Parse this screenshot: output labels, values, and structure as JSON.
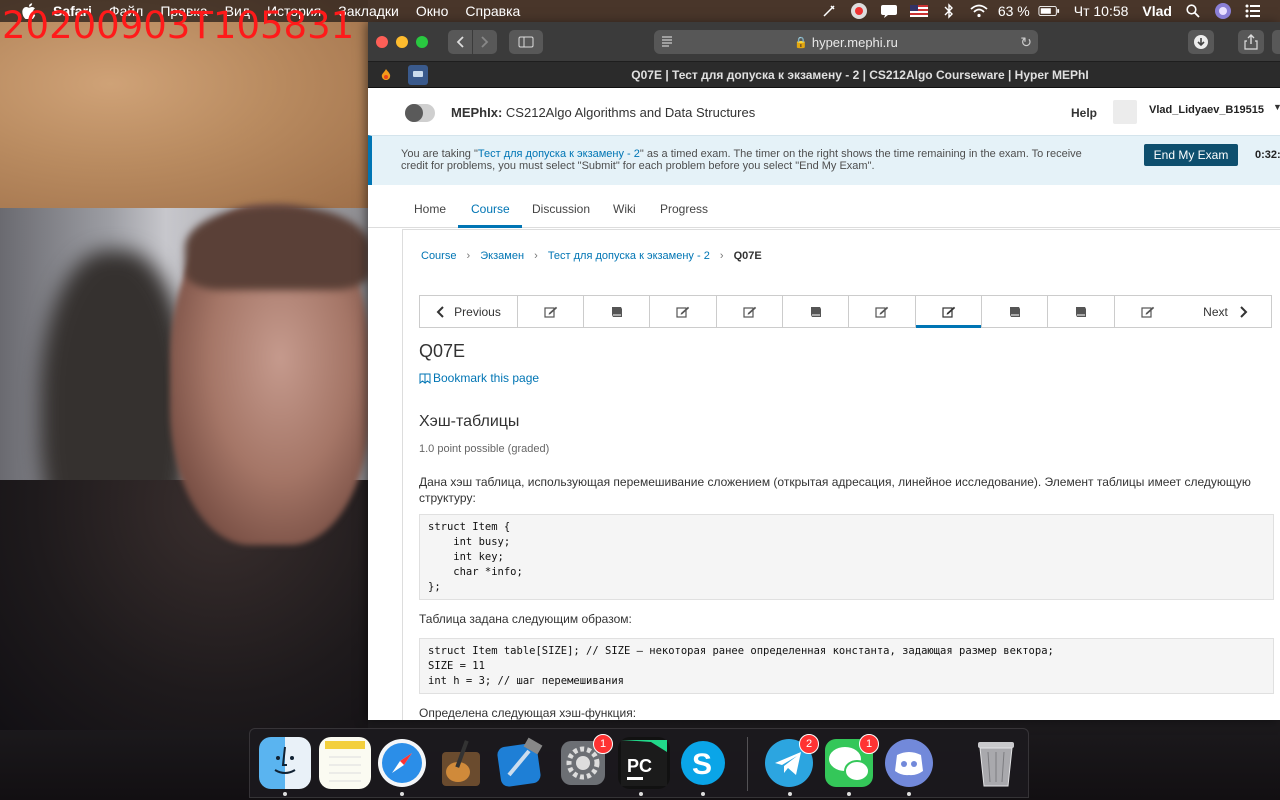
{
  "recording_stamp": "20200903T105831",
  "menubar": {
    "app": "Safari",
    "menus": [
      "Файл",
      "Правка",
      "Вид",
      "История",
      "Закладки",
      "Окно",
      "Справка"
    ],
    "battery": "63 %",
    "clock": "Чт 10:58",
    "user": "Vlad"
  },
  "browser": {
    "url": "hyper.mephi.ru",
    "tab_title": "Q07E | Тест для допуска к экзамену - 2 | CS212Algo Courseware | Hyper MEPhI"
  },
  "header": {
    "platform": "MEPhIx:",
    "course": "CS212Algo Algorithms and Data Structures",
    "help": "Help",
    "username": "Vlad_Lidyaev_B19515"
  },
  "exam_banner": {
    "text_before": "You are taking \"",
    "exam_link": "Тест для допуска к экзамену - 2",
    "text_after": "\" as a timed exam. The timer on the right shows the time remaining in the exam. To receive credit for problems, you must select \"Submit\" for each problem before you select \"End My Exam\".",
    "end_button": "End My Exam",
    "timer": "0:32:"
  },
  "course_tabs": [
    "Home",
    "Course",
    "Discussion",
    "Wiki",
    "Progress"
  ],
  "breadcrumb": {
    "items": [
      "Course",
      "Экзамен",
      "Тест для допуска к экзамену - 2"
    ],
    "current": "Q07E"
  },
  "sequence": {
    "previous": "Previous",
    "next": "Next",
    "items": [
      "edit-icon",
      "book-icon",
      "edit-icon",
      "edit-icon",
      "book-icon",
      "edit-icon",
      "edit-icon",
      "book-icon",
      "book-icon",
      "edit-icon"
    ],
    "active_index": 6
  },
  "unit": {
    "title": "Q07E",
    "bookmark": "Bookmark this page"
  },
  "problem": {
    "title": "Хэш-таблицы",
    "points": "1.0 point possible (graded)",
    "intro": "Дана хэш таблица, использующая перемешивание сложением (открытая адресация, линейное исследование). Элемент таблицы имеет следующую структуру:",
    "code1": "struct Item {\n    int busy;\n    int key;\n    char *info;\n};",
    "table_text": "Таблица задана следующим образом:",
    "code2": "struct Item table[SIZE]; // SIZE – некоторая ранее определенная константа, задающая размер вектора;\nSIZE = 11\nint h = 3; // шаг перемешивания",
    "hash_text": "Определена следующая хэш-функция:"
  },
  "dock": {
    "apps": [
      "Finder",
      "Notes",
      "Safari",
      "GarageBand",
      "Xcode",
      "System Preferences",
      "PyCharm",
      "Skype",
      "Telegram",
      "Messages",
      "Discord",
      "Trash"
    ],
    "badges": {
      "System Preferences": "1",
      "Telegram": "2",
      "Messages": "1"
    }
  }
}
